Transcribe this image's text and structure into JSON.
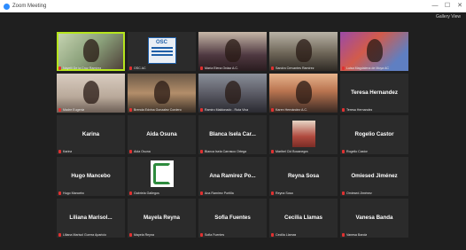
{
  "window": {
    "title": "Zoom Meeting",
    "minimize": "—",
    "maximize": "☐",
    "close": "✕"
  },
  "view": {
    "label": "Gallery View"
  },
  "tiles": [
    {
      "name": "",
      "tag": "Nayelli De la Cruz Ramírez",
      "style": "video",
      "active": true
    },
    {
      "name": "",
      "tag": "OSC AC",
      "style": "logo-osc",
      "logo_text": "OSC"
    },
    {
      "name": "",
      "tag": "María Elena Ordaz A.C.",
      "style": "video"
    },
    {
      "name": "",
      "tag": "Sandra Cervantes Ramírez",
      "style": "video"
    },
    {
      "name": "",
      "tag": "Luisa Magdalena de Moya AC",
      "style": "video"
    },
    {
      "name": "",
      "tag": "Madre Eugenia",
      "style": "video"
    },
    {
      "name": "",
      "tag": "Brenda Edvina Gonzalez Cordero",
      "style": "video"
    },
    {
      "name": "",
      "tag": "Ramiro Maldonado - Ruta Viva",
      "style": "video"
    },
    {
      "name": "",
      "tag": "Karen Hernández A.C.",
      "style": "video"
    },
    {
      "name": "Teresa Hernandez",
      "tag": "Teresa Hernandez",
      "style": "name"
    },
    {
      "name": "Karina",
      "tag": "Karina",
      "style": "name"
    },
    {
      "name": "Aida Osuna",
      "tag": "Aida Osuna",
      "style": "name"
    },
    {
      "name": "Blanca Isela Car...",
      "tag": "Blanca Isela Carrasco Ortega",
      "style": "name"
    },
    {
      "name": "",
      "tag": "Maribel Cid Bocanegra",
      "style": "photo"
    },
    {
      "name": "Rogelio Castor",
      "tag": "Rogelio Castor",
      "style": "name"
    },
    {
      "name": "Hugo Mancebo",
      "tag": "Hugo Mancebo",
      "style": "name"
    },
    {
      "name": "",
      "tag": "Gabriela Gallegos",
      "style": "logo-green"
    },
    {
      "name": "Ana Ramirez Po...",
      "tag": "Ana Ramirez Portilla",
      "style": "name"
    },
    {
      "name": "Reyna Sosa",
      "tag": "Reyna Sosa",
      "style": "name"
    },
    {
      "name": "Omiesed Jiménez",
      "tag": "Omiesed Jiménez",
      "style": "name"
    },
    {
      "name": "Liliana  Marisol...",
      "tag": "Liliana Marisol Guerra Aparicio",
      "style": "name"
    },
    {
      "name": "Mayela Reyna",
      "tag": "Mayela Reyna",
      "style": "name"
    },
    {
      "name": "Sofia Fuentes",
      "tag": "Sofia Fuentes",
      "style": "name"
    },
    {
      "name": "Cecilia Llamas",
      "tag": "Cecilia Llamas",
      "style": "name"
    },
    {
      "name": "Vanesa Banda",
      "tag": "Vanesa Banda",
      "style": "name"
    }
  ]
}
